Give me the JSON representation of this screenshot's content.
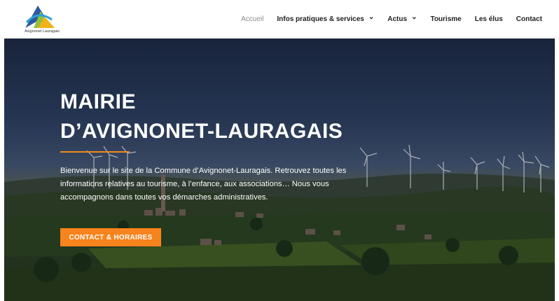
{
  "header": {
    "logo_text": "Avignonet Lauragais",
    "nav": [
      {
        "label": "Accueil",
        "dropdown": false,
        "active": true
      },
      {
        "label": "Infos pratiques & services",
        "dropdown": true,
        "active": false
      },
      {
        "label": "Actus",
        "dropdown": true,
        "active": false
      },
      {
        "label": "Tourisme",
        "dropdown": false,
        "active": false
      },
      {
        "label": "Les élus",
        "dropdown": false,
        "active": false
      },
      {
        "label": "Contact",
        "dropdown": false,
        "active": false
      }
    ]
  },
  "hero": {
    "title_line1": "MAIRIE",
    "title_line2": "D’AVIGNONET-LAURAGAIS",
    "text": "Bienvenue sur le site de la Commune d’Avignonet-Lauragais. Retrouvez toutes les informations relatives au tourisme, à l’enfance, aux associations… Nous vous accompagnons dans toutes vos démarches administratives.",
    "cta_label": "CONTACT & HORAIRES"
  },
  "colors": {
    "accent": "#f7831d",
    "active_nav": "#888888",
    "nav": "#222222"
  },
  "icons": {
    "dropdown": "chevron-down-icon",
    "logo": "mountain-logo-icon"
  }
}
